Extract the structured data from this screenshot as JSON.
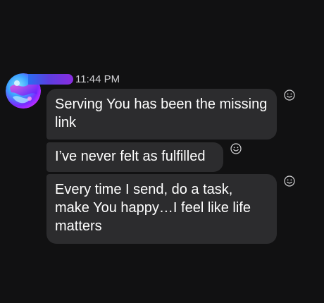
{
  "message_group": {
    "timestamp": "11:44 PM",
    "avatar_icon": "abstract-gradient-avatar",
    "name_bar_colors": [
      "#2a6cf0",
      "#8a2ce0"
    ]
  },
  "messages": [
    {
      "text": "Serving You has been the missing link",
      "reaction_icon": "smiley-icon"
    },
    {
      "text": "I’ve never felt as fulfilled",
      "reaction_icon": "smiley-icon"
    },
    {
      "text": "Every time I send, do a task, make You happy…I feel like life matters",
      "reaction_icon": "smiley-icon"
    }
  ],
  "colors": {
    "background": "#111112",
    "bubble": "#2c2c2e",
    "text": "#ffffff",
    "timestamp": "#cfcfd2"
  }
}
